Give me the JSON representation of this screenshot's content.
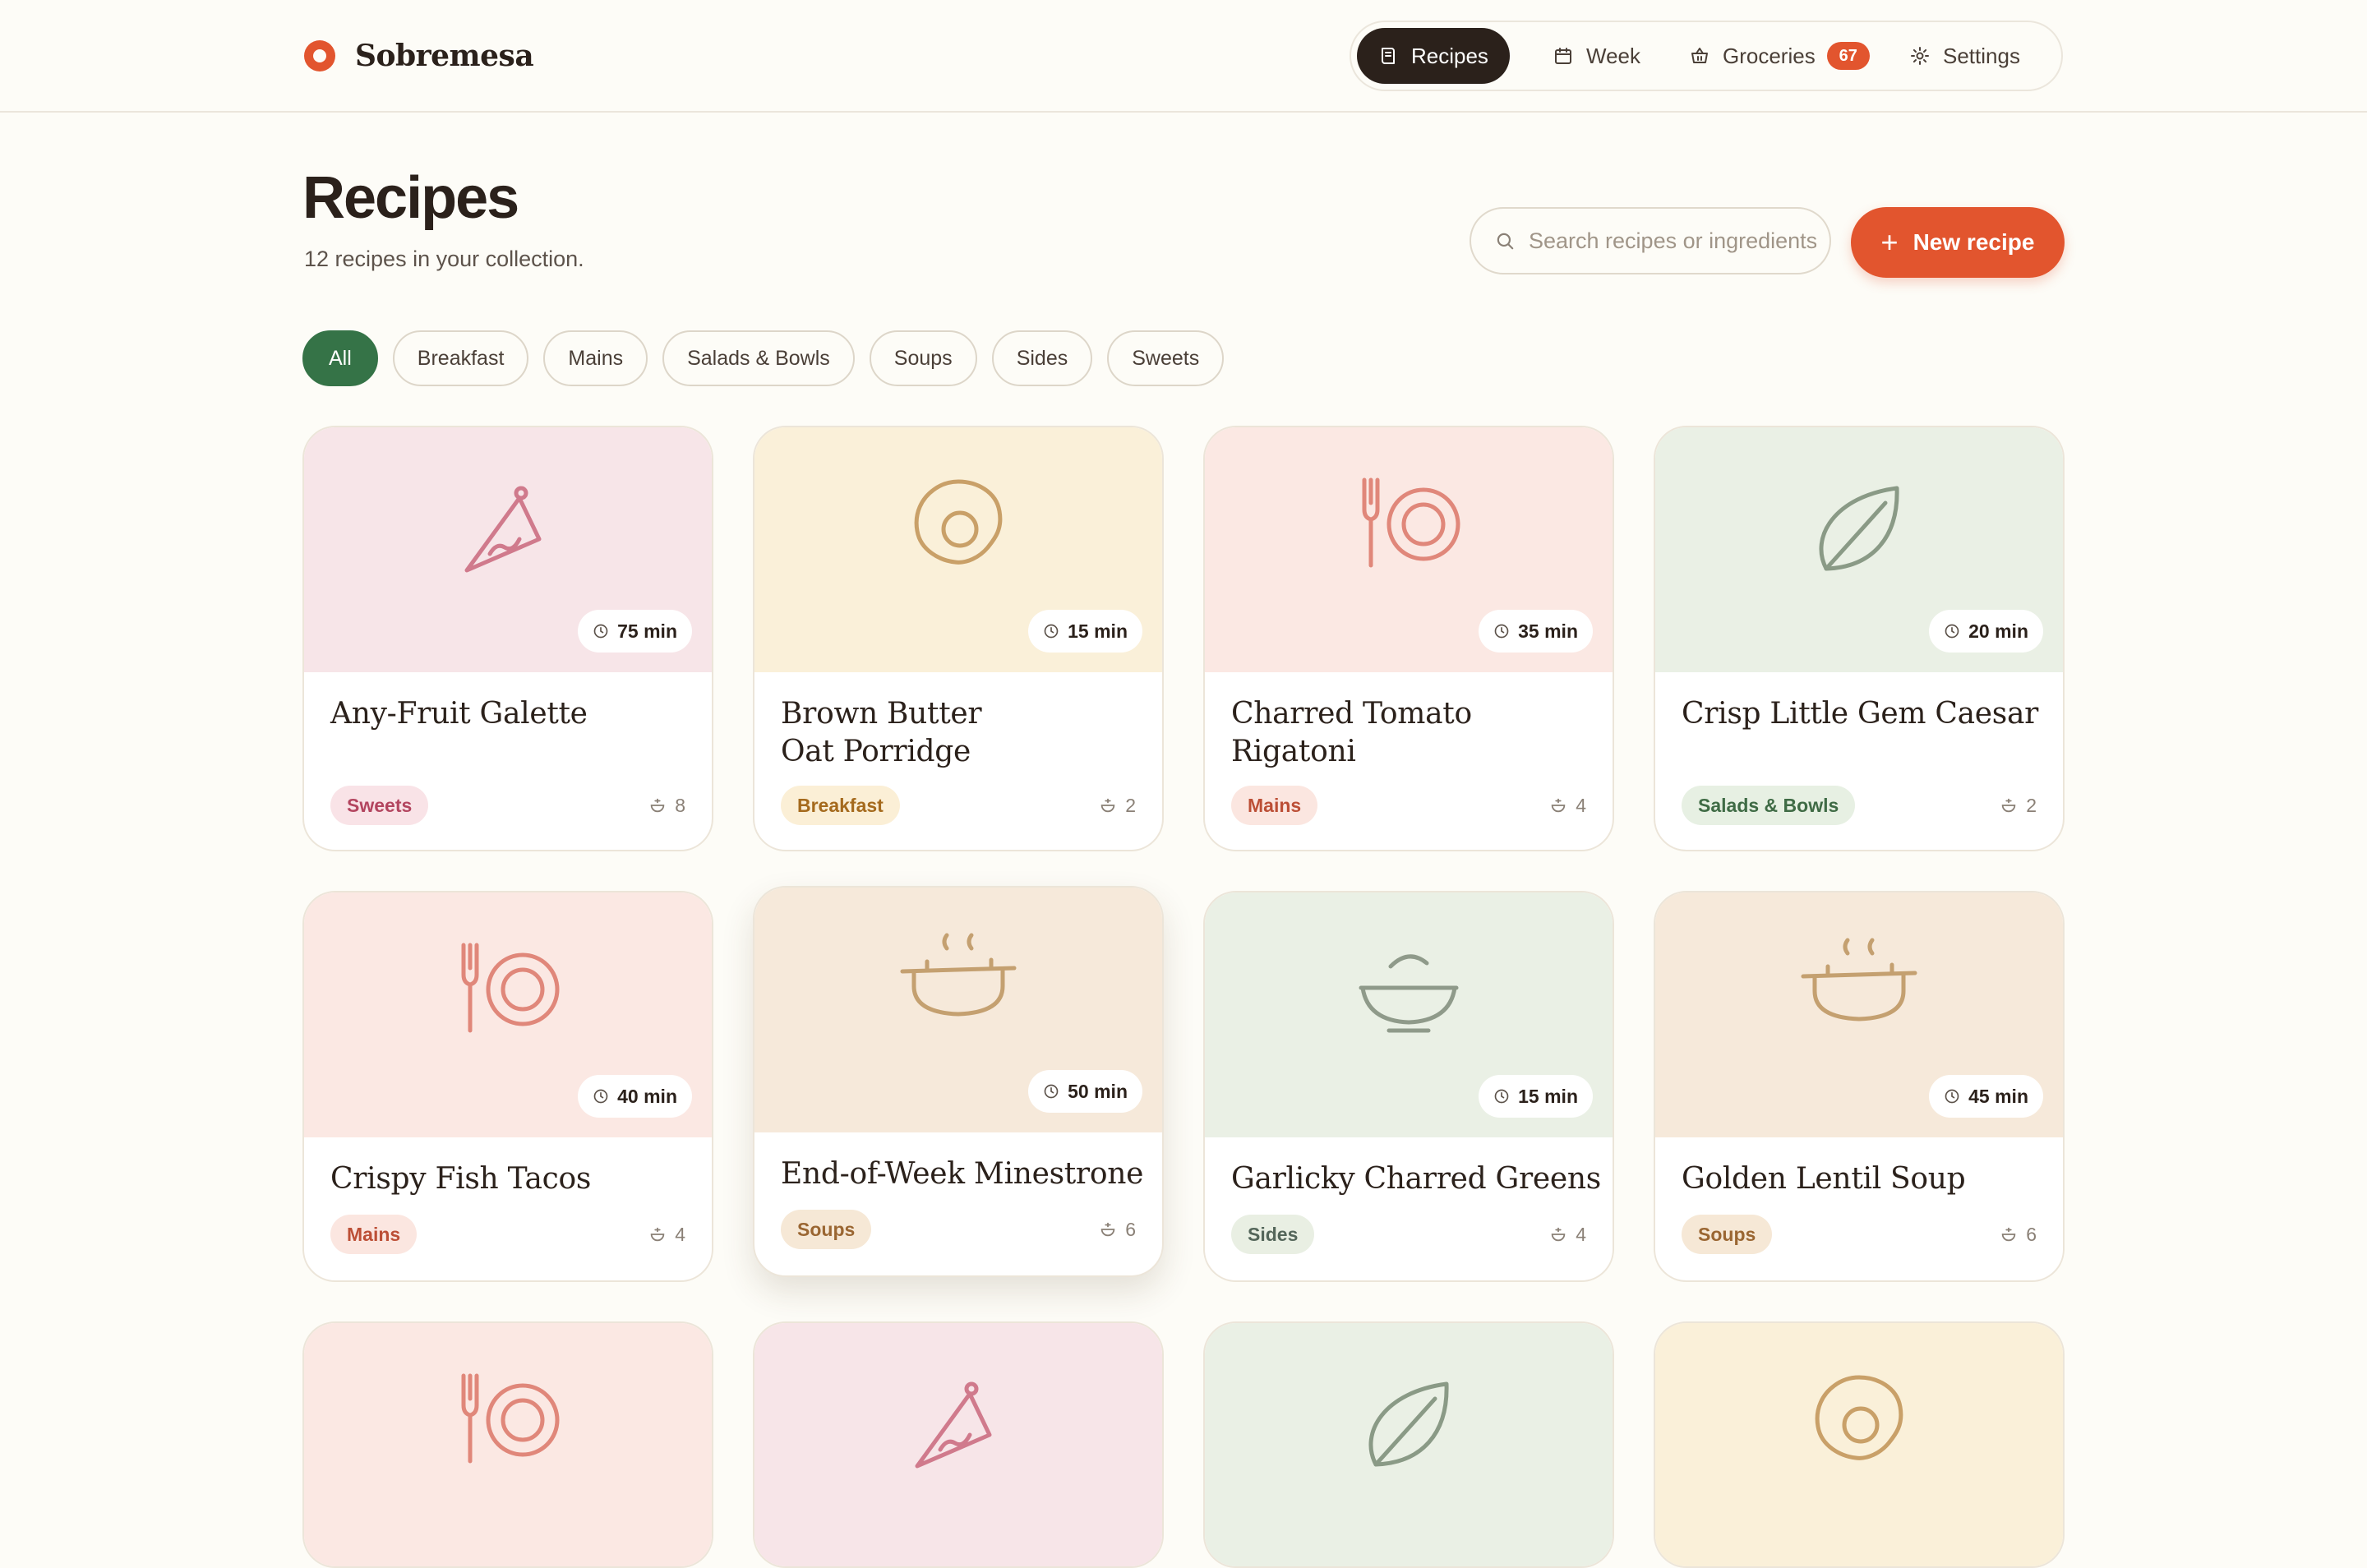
{
  "brand": {
    "name": "Sobremesa"
  },
  "nav": {
    "items": [
      {
        "label": "Recipes",
        "icon": "book-icon",
        "active": true
      },
      {
        "label": "Week",
        "icon": "calendar-icon"
      },
      {
        "label": "Groceries",
        "icon": "basket-icon",
        "badge": "67"
      },
      {
        "label": "Settings",
        "icon": "gear-icon"
      }
    ]
  },
  "header": {
    "title": "Recipes",
    "subtitle": "12 recipes in your collection."
  },
  "search": {
    "placeholder": "Search recipes or ingredients"
  },
  "new_recipe": {
    "label": "New recipe"
  },
  "filters": {
    "items": [
      "All",
      "Breakfast",
      "Mains",
      "Salads & Bowls",
      "Soups",
      "Sides",
      "Sweets"
    ],
    "active": "All"
  },
  "recipes": [
    {
      "title": "Any-Fruit Galette",
      "time": "75 min",
      "tag": "Sweets",
      "servings": "8",
      "icon": "pie-slice-icon",
      "color": "#d07a8c"
    },
    {
      "title": "Brown Butter Oat Porridge",
      "time": "15 min",
      "tag": "Breakfast",
      "servings": "2",
      "icon": "egg-icon",
      "color": "#c9a068"
    },
    {
      "title": "Charred Tomato Rigatoni",
      "time": "35 min",
      "tag": "Mains",
      "servings": "4",
      "icon": "plate-fork-icon",
      "color": "#e0877a"
    },
    {
      "title": "Crisp Little Gem Caesar",
      "time": "20 min",
      "tag": "Salads & Bowls",
      "servings": "2",
      "icon": "leaf-icon",
      "color": "#8a9a86"
    },
    {
      "title": "Crispy Fish Tacos",
      "time": "40 min",
      "tag": "Mains",
      "servings": "4",
      "icon": "plate-fork-icon",
      "color": "#e0877a"
    },
    {
      "title": "End-of-Week Minestrone",
      "time": "50 min",
      "tag": "Soups",
      "servings": "6",
      "icon": "pot-icon",
      "color": "#c4a070"
    },
    {
      "title": "Garlicky Charred Greens",
      "time": "15 min",
      "tag": "Sides",
      "servings": "4",
      "icon": "bowl-icon",
      "color": "#8f9a8a"
    },
    {
      "title": "Golden Lentil Soup",
      "time": "45 min",
      "tag": "Soups",
      "servings": "6",
      "icon": "pot-icon",
      "color": "#c4a070"
    },
    {
      "icon": "plate-fork-icon",
      "color": "#e0877a"
    },
    {
      "icon": "pie-slice-icon",
      "color": "#d07a8c"
    },
    {
      "icon": "leaf-icon",
      "color": "#8a9a86"
    },
    {
      "icon": "egg-icon",
      "color": "#c9a068"
    }
  ]
}
